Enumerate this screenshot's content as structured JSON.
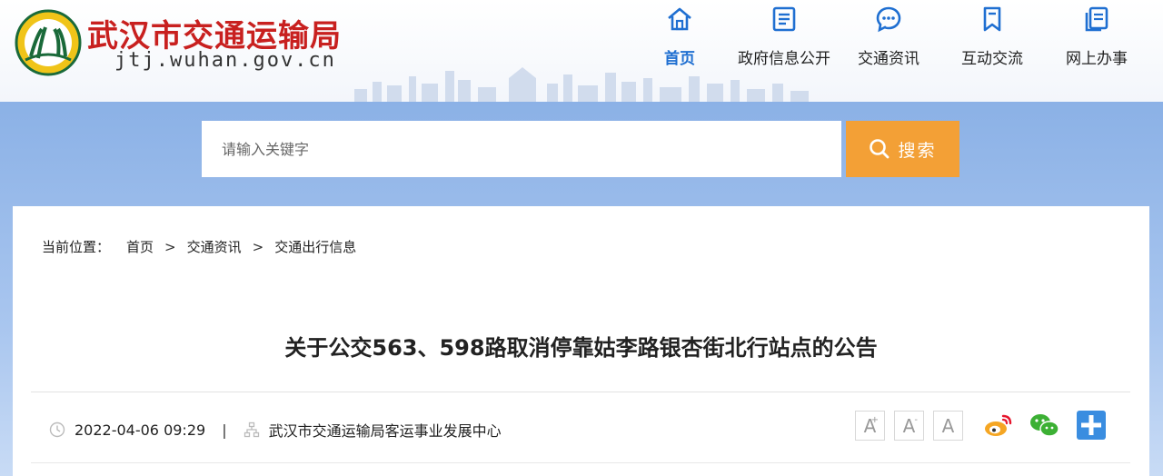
{
  "site": {
    "title": "武汉市交通运输局",
    "domain": "jtj.wuhan.gov.cn"
  },
  "nav": {
    "items": [
      {
        "label": "首页",
        "icon": "home-icon",
        "active": true
      },
      {
        "label": "政府信息公开",
        "icon": "document-icon",
        "active": false
      },
      {
        "label": "交通资讯",
        "icon": "chat-icon",
        "active": false
      },
      {
        "label": "互动交流",
        "icon": "bookmark-icon",
        "active": false
      },
      {
        "label": "网上办事",
        "icon": "files-icon",
        "active": false
      }
    ]
  },
  "search": {
    "placeholder": "请输入关键字",
    "button_label": "搜索"
  },
  "breadcrumb": {
    "prefix": "当前位置：",
    "items": [
      "首页",
      "交通资讯",
      "交通出行信息"
    ],
    "separator": ">"
  },
  "article": {
    "title": "关于公交563、598路取消停靠姑李路银杏街北行站点的公告",
    "date": "2022-04-06 09:29",
    "source": "武汉市交通运输局客运事业发展中心"
  },
  "font_controls": {
    "increase": "A",
    "decrease": "A",
    "reset": "A",
    "increase_mark": "+",
    "decrease_mark": "-"
  },
  "colors": {
    "title_red": "#c8201f",
    "nav_active": "#1f6fd1",
    "search_orange": "#f3a036",
    "band_blue": "#8bb1e6"
  }
}
